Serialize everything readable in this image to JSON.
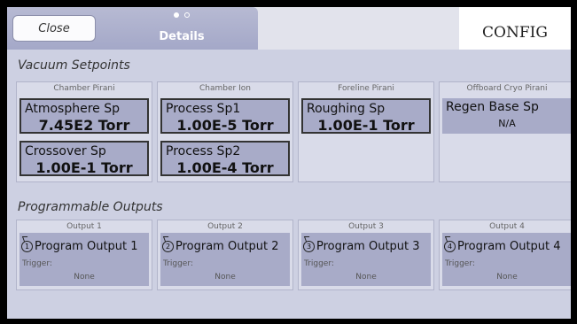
{
  "header": {
    "close_label": "Close",
    "details_label": "Details",
    "config_label": "CONFIG"
  },
  "vacuum": {
    "title": "Vacuum Setpoints",
    "panels": [
      {
        "title": "Chamber Pirani",
        "setpoints": [
          {
            "name": "Atmosphere Sp",
            "value": "7.45E2 Torr"
          },
          {
            "name": "Crossover Sp",
            "value": "1.00E-1 Torr"
          }
        ]
      },
      {
        "title": "Chamber Ion",
        "setpoints": [
          {
            "name": "Process Sp1",
            "value": "1.00E-5 Torr"
          },
          {
            "name": "Process Sp2",
            "value": "1.00E-4 Torr"
          }
        ]
      },
      {
        "title": "Foreline Pirani",
        "setpoints": [
          {
            "name": "Roughing Sp",
            "value": "1.00E-1 Torr"
          }
        ]
      },
      {
        "title": "Offboard Cryo Pirani",
        "setpoints": [
          {
            "name": "Regen Base Sp",
            "value": "N/A"
          }
        ]
      }
    ]
  },
  "outputs": {
    "title": "Programmable Outputs",
    "trigger_label": "Trigger:",
    "items": [
      {
        "title": "Output 1",
        "number": "1",
        "name": "Program Output 1",
        "trigger": "None"
      },
      {
        "title": "Output 2",
        "number": "2",
        "name": "Program Output 2",
        "trigger": "None"
      },
      {
        "title": "Output 3",
        "number": "3",
        "name": "Program Output 3",
        "trigger": "None"
      },
      {
        "title": "Output 4",
        "number": "4",
        "name": "Program Output 4",
        "trigger": "None"
      }
    ]
  }
}
